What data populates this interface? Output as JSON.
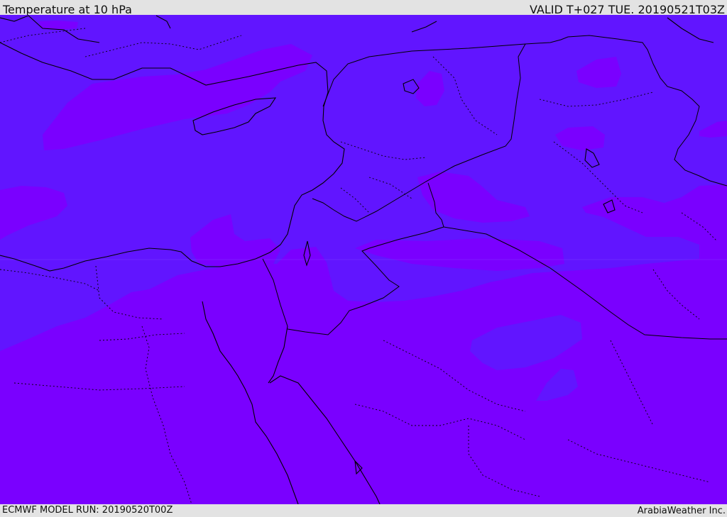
{
  "header": {
    "title": "Temperature at 10 hPa",
    "valid": "VALID T+027 TUE. 20190521T03Z"
  },
  "footer": {
    "model_run": "ECMWF MODEL RUN: 20190520T00Z",
    "credit": "ArabiaWeather Inc."
  },
  "map": {
    "variable": "Temperature",
    "level": "10 hPa",
    "region": "Eastern Mediterranean / Middle East",
    "colors": {
      "cool_shade": "#6115ff",
      "warm_shade": "#7a00ff",
      "coastline": "#000000",
      "borders": "#000000"
    }
  }
}
